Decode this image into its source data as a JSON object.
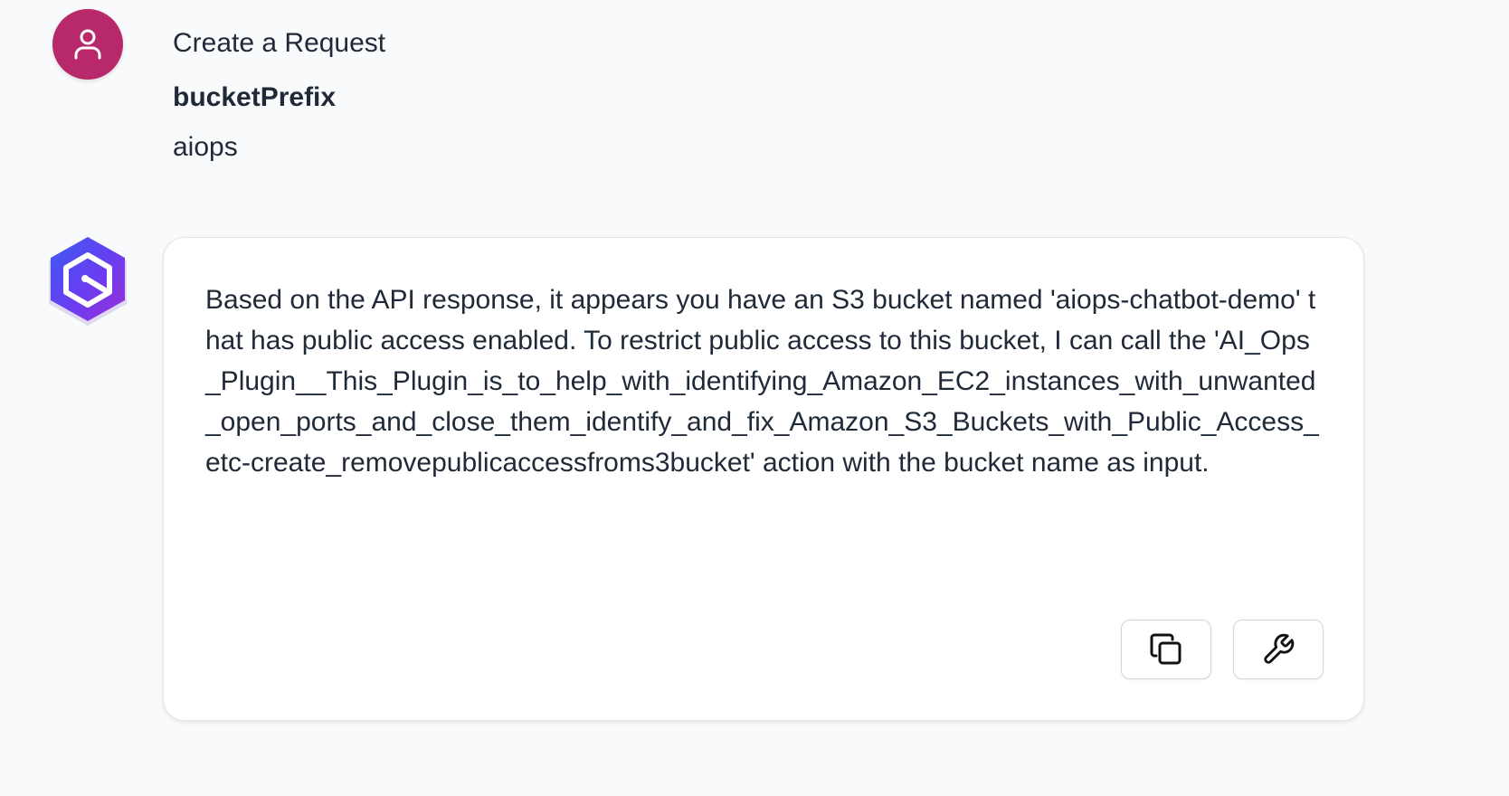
{
  "user_message": {
    "avatar_icon": "user-icon",
    "avatar_color": "#b8296c",
    "title": "Create a Request",
    "param_name": "bucketPrefix",
    "param_value": "aiops"
  },
  "bot_message": {
    "avatar_icon": "hexagon-logo-icon",
    "text": "Based on the API response, it appears you have an S3 bucket named 'aiops-chatbot-demo' that has public access enabled. To restrict public access to this bucket, I can call the 'AI_Ops_Plugin__This_Plugin_is_to_help_with_identifying_Amazon_EC2_instances_with_unwanted_open_ports_and_close_them_identify_and_fix_Amazon_S3_Buckets_with_Public_Access_etc-create_removepublicaccessfroms3bucket' action with the bucket name as input.",
    "actions": [
      {
        "icon": "copy-icon"
      },
      {
        "icon": "wrench-icon"
      }
    ]
  }
}
